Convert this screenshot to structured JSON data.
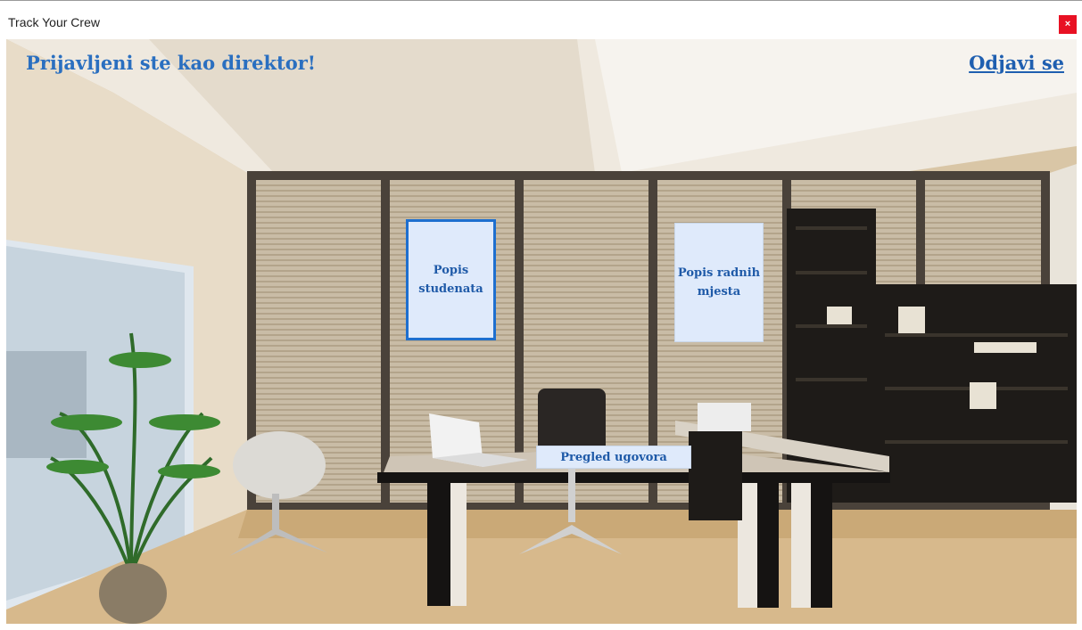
{
  "window": {
    "title": "Track Your Crew",
    "close_label": "×"
  },
  "header": {
    "greeting": "Prijavljeni ste kao direktor!",
    "logout_label": "Odjavi se"
  },
  "tiles": {
    "students": "Popis studenata",
    "jobs": "Popis radnih mjesta",
    "contracts": "Pregled ugovora"
  },
  "colors": {
    "accent": "#2a6fc0",
    "tile_bg": "#dfeafb",
    "tile_border_active": "#1e6fcf",
    "close_bg": "#e81123"
  }
}
